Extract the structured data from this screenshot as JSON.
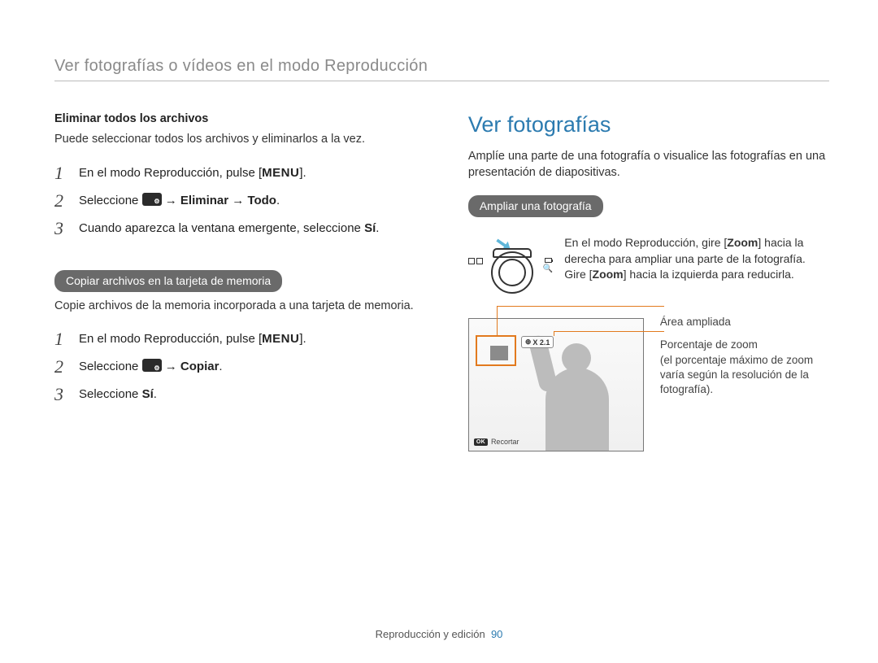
{
  "pageTitle": "Ver fotografías o vídeos en el modo Reproducción",
  "left": {
    "deleteAll": {
      "heading": "Eliminar todos los archivos",
      "intro": "Puede seleccionar todos los archivos y eliminarlos a la vez.",
      "steps": {
        "s1a": "En el modo Reproducción, pulse [",
        "s1menu": "MENU",
        "s1b": "].",
        "s2a": "Seleccione ",
        "s2b": " → ",
        "s2c": "Eliminar",
        "s2d": " → ",
        "s2e": "Todo",
        "s2f": ".",
        "s3a": "Cuando aparezca la ventana emergente, seleccione ",
        "s3b": "Sí",
        "s3c": "."
      }
    },
    "copy": {
      "pill": "Copiar archivos en la tarjeta de memoria",
      "intro": "Copie archivos de la memoria incorporada a una tarjeta de memoria.",
      "steps": {
        "s1a": "En el modo Reproducción, pulse [",
        "s1menu": "MENU",
        "s1b": "].",
        "s2a": "Seleccione ",
        "s2b": " → ",
        "s2c": "Copiar",
        "s2d": ".",
        "s3a": "Seleccione ",
        "s3b": "Sí",
        "s3c": "."
      }
    }
  },
  "right": {
    "heading": "Ver fotografías",
    "intro": "Amplíe una parte de una fotografía o visualice las fotografías en una presentación de diapositivas.",
    "pill": "Ampliar una fotografía",
    "zoomDesc": {
      "a": "En el modo Reproducción, gire [",
      "b": "Zoom",
      "c": "] hacia la derecha para ampliar una parte de la fotografía. Gire [",
      "d": "Zoom",
      "e": "] hacia la izquierda para reducirla."
    },
    "zoomBadge": "X 2.1",
    "cropLabel": "Recortar",
    "okLabel": "OK",
    "callouts": {
      "area": "Área ampliada",
      "ratioLine1": "Porcentaje de zoom",
      "ratioLine2": "(el porcentaje máximo de zoom varía según la resolución de la fotografía)."
    }
  },
  "footer": {
    "section": "Reproducción y edición",
    "page": "90"
  }
}
